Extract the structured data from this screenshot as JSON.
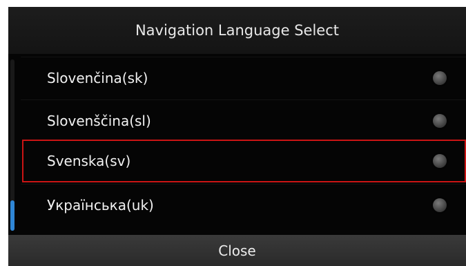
{
  "header": {
    "title": "Navigation Language Select"
  },
  "languages": [
    {
      "label": "Slovenčina(sk)"
    },
    {
      "label": "Slovenščina(sl)"
    },
    {
      "label": "Svenska(sv)"
    },
    {
      "label": "Українська(uk)"
    }
  ],
  "footer": {
    "close_label": "Close"
  },
  "colors": {
    "highlight": "#cc1414",
    "scroll_thumb": "#2f86d6"
  }
}
